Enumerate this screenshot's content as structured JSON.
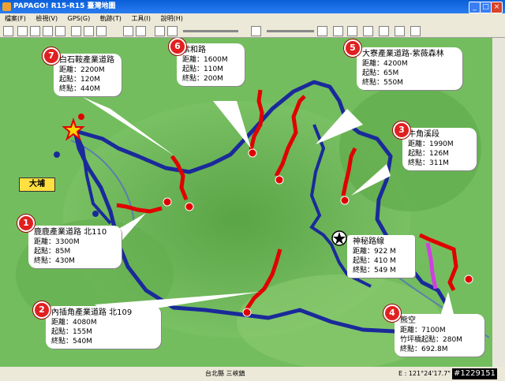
{
  "window": {
    "title": "PAPAGO! R15-R15 臺灣地圖",
    "controls": [
      "_",
      "□",
      "×"
    ]
  },
  "menu": [
    "檔案(F)",
    "檢視(V)",
    "GPS(G)",
    "軌跡(T)",
    "工具(I)",
    "說明(H)"
  ],
  "colors": {
    "route_main": "#1a2a9a",
    "route_side": "#e00000",
    "route_purple": "#d040e0",
    "badge": "#e02020",
    "map_green": "#6fb85a"
  },
  "town": "大埔",
  "callouts": [
    {
      "num": "1",
      "title": "鹿鹿產業道路 北110",
      "lines": [
        "距離：3300M",
        "起點：85M",
        "終點：430M"
      ]
    },
    {
      "num": "2",
      "title": "內插角產業道路 北109",
      "lines": [
        "距離：4080M",
        "起點：155M",
        "終點：540M"
      ]
    },
    {
      "num": "3",
      "title": "牛角溪段",
      "lines": [
        "距離：1990M",
        "起點：126M",
        "終點：311M"
      ]
    },
    {
      "num": "4",
      "title": "熊空",
      "lines": [
        "距離：7100M",
        "竹坪橋起點：280M",
        "終點：692.8M"
      ]
    },
    {
      "num": "5",
      "title": "大寮產業道路-紫薇森林",
      "lines": [
        "距離：4200M",
        "起點：65M",
        "終點：550M"
      ]
    },
    {
      "num": "6",
      "title": "紫和路",
      "lines": [
        "距離：1600M",
        "起點：110M",
        "終點：200M"
      ]
    },
    {
      "num": "7",
      "title": "白石鞍產業道路",
      "lines": [
        "距離：2200M",
        "起點：120M",
        "終點：440M"
      ]
    },
    {
      "num": "★",
      "title": "神秘路線",
      "lines": [
        "距離：922 M",
        "起點：410 M",
        "終點：549 M"
      ]
    }
  ],
  "status": {
    "location": "台北縣 三峽鎮",
    "coord": "E : 121°24'17.7\"",
    "watermark": "#1229151"
  }
}
